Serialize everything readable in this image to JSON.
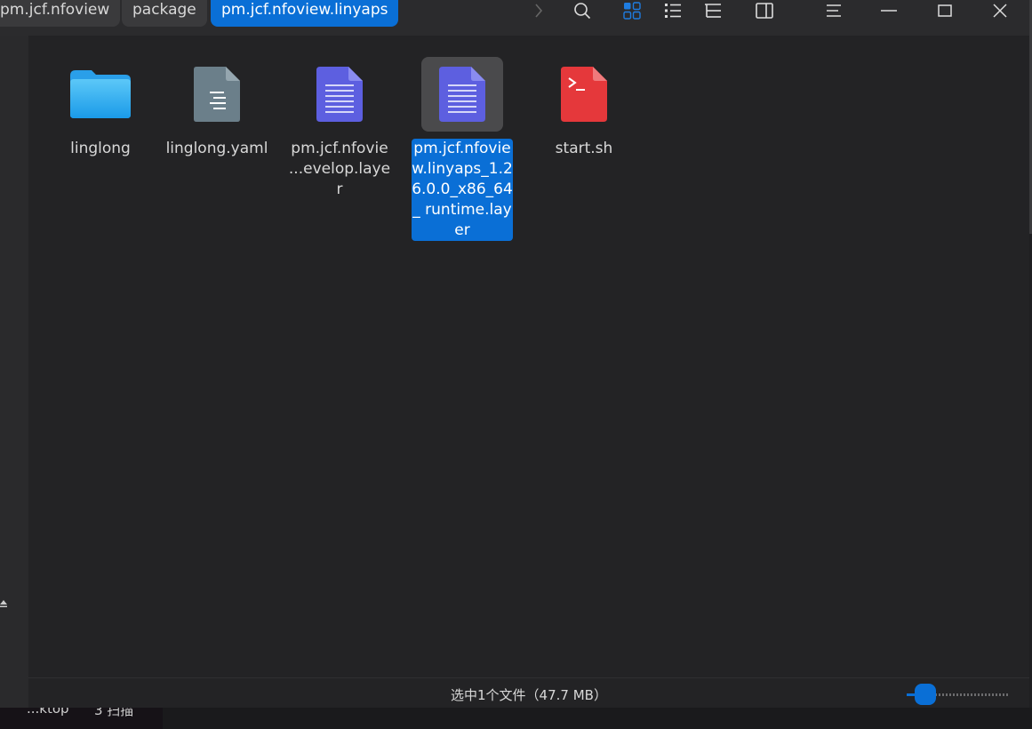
{
  "breadcrumbs": [
    {
      "label": "pm.jcf.nfoview",
      "active": false
    },
    {
      "label": "package",
      "active": false
    },
    {
      "label": "pm.jcf.nfoview.linyaps",
      "active": true
    }
  ],
  "toolbar": {
    "icons": [
      "chevron-right-icon",
      "search-icon",
      "icon-view-icon",
      "list-view-icon",
      "tree-view-icon",
      "detail-panel-icon",
      "menu-icon",
      "minimize-icon",
      "maximize-icon",
      "close-icon"
    ],
    "accent": "#0a6fd6"
  },
  "files": [
    {
      "name": "linglong",
      "type": "folder",
      "icon": "folder-icon"
    },
    {
      "name": "linglong.yaml",
      "type": "text",
      "icon": "yaml-file-icon"
    },
    {
      "name": "pm.jcf.nfovie\n...evelop.layer",
      "type": "layer",
      "icon": "layer-file-icon"
    },
    {
      "name": "pm.jcf.nfovie w.linyaps_1.2 6.0.0_x86_64_ runtime.layer",
      "type": "layer",
      "icon": "layer-file-icon",
      "selected": true
    },
    {
      "name": "start.sh",
      "type": "script",
      "icon": "shell-script-icon"
    }
  ],
  "status": {
    "text": "选中1个文件（47.7 MB）",
    "zoom_level": 0.1
  },
  "taskbar": {
    "items": [
      "...ktop",
      "3 扫描"
    ]
  }
}
